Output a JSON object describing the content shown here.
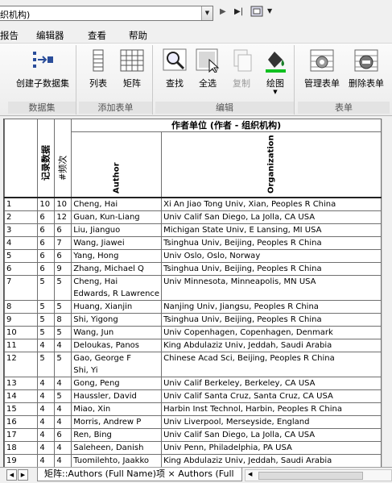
{
  "toolbar": {
    "combo_value": "织机构)"
  },
  "menu": [
    "报告",
    "编辑器",
    "查看",
    "帮助"
  ],
  "ribbon": {
    "groups": [
      {
        "label": "数据集",
        "buttons": [
          {
            "label": "创建子数据集",
            "icon": "create-subset-icon"
          }
        ]
      },
      {
        "label": "添加表单",
        "buttons": [
          {
            "label": "列表",
            "icon": "list-icon"
          },
          {
            "label": "矩阵",
            "icon": "matrix-icon"
          }
        ]
      },
      {
        "label": "编辑",
        "buttons": [
          {
            "label": "查找",
            "icon": "find-icon"
          },
          {
            "label": "全选",
            "icon": "select-all-icon"
          },
          {
            "label": "复制",
            "icon": "copy-icon",
            "disabled": true
          },
          {
            "label": "绘图",
            "icon": "draw-icon"
          }
        ]
      },
      {
        "label": "表单",
        "buttons": [
          {
            "label": "管理表单",
            "icon": "manage-forms-icon"
          },
          {
            "label": "删除表单",
            "icon": "delete-form-icon"
          }
        ]
      }
    ]
  },
  "grid": {
    "group_header": "作者单位 (作者 - 组织机构)",
    "col_headers": {
      "record_count": "记录数据",
      "freq": "#频次",
      "author": "Author",
      "organization": "Organization"
    },
    "rows": [
      {
        "n": "1",
        "rec": "10",
        "freq": "10",
        "author": "Cheng, Hai",
        "org": "Xi An Jiao Tong Univ, Xian, Peoples R China"
      },
      {
        "n": "2",
        "rec": "6",
        "freq": "12",
        "author": "Guan, Kun-Liang",
        "org": "Univ Calif San Diego, La Jolla, CA USA"
      },
      {
        "n": "3",
        "rec": "6",
        "freq": "6",
        "author": "Liu, Jianguo",
        "org": "Michigan State Univ, E Lansing, MI USA"
      },
      {
        "n": "4",
        "rec": "6",
        "freq": "7",
        "author": "Wang, Jiawei",
        "org": "Tsinghua Univ, Beijing, Peoples R China"
      },
      {
        "n": "5",
        "rec": "6",
        "freq": "6",
        "author": "Yang, Hong",
        "org": "Univ Oslo, Oslo, Norway"
      },
      {
        "n": "6",
        "rec": "6",
        "freq": "9",
        "author": "Zhang, Michael Q",
        "org": "Tsinghua Univ, Beijing, Peoples R China"
      },
      {
        "n": "7",
        "rec": "5",
        "freq": "5",
        "author": "Cheng, Hai",
        "author2": "Edwards, R Lawrence",
        "org": "Univ Minnesota, Minneapolis, MN USA",
        "tall": true
      },
      {
        "n": "8",
        "rec": "5",
        "freq": "5",
        "author": "Huang, Xianjin",
        "org": "Nanjing Univ, Jiangsu, Peoples R China"
      },
      {
        "n": "9",
        "rec": "5",
        "freq": "8",
        "author": "Shi, Yigong",
        "org": "Tsinghua Univ, Beijing, Peoples R China"
      },
      {
        "n": "10",
        "rec": "5",
        "freq": "5",
        "author": "Wang, Jun",
        "org": "Univ Copenhagen, Copenhagen, Denmark"
      },
      {
        "n": "11",
        "rec": "4",
        "freq": "4",
        "author": "Deloukas, Panos",
        "org": "King Abdulaziz Univ, Jeddah, Saudi Arabia"
      },
      {
        "n": "12",
        "rec": "5",
        "freq": "5",
        "author": "Gao, George F",
        "author2": "Shi, Yi",
        "org": "Chinese Acad Sci, Beijing, Peoples R China",
        "tall": true
      },
      {
        "n": "13",
        "rec": "4",
        "freq": "4",
        "author": "Gong, Peng",
        "org": "Univ Calif Berkeley, Berkeley, CA USA"
      },
      {
        "n": "14",
        "rec": "4",
        "freq": "5",
        "author": "Haussler, David",
        "org": "Univ Calif Santa Cruz, Santa Cruz, CA USA"
      },
      {
        "n": "15",
        "rec": "4",
        "freq": "4",
        "author": "Miao, Xin",
        "org": "Harbin Inst Technol, Harbin, Peoples R China"
      },
      {
        "n": "16",
        "rec": "4",
        "freq": "4",
        "author": "Morris, Andrew P",
        "org": "Univ Liverpool, Merseyside, England"
      },
      {
        "n": "17",
        "rec": "4",
        "freq": "6",
        "author": "Ren, Bing",
        "org": "Univ Calif San Diego, La Jolla, CA USA"
      },
      {
        "n": "18",
        "rec": "4",
        "freq": "4",
        "author": "Saleheen, Danish",
        "org": "Univ Penn, Philadelphia, PA USA"
      },
      {
        "n": "19",
        "rec": "4",
        "freq": "4",
        "author": "Tuomilehto, Jaakko",
        "org": "King Abdulaziz Univ, Jeddah, Saudi Arabia"
      }
    ]
  },
  "sheet_tab": "矩阵::Authors (Full Name)项 × Authors (Full"
}
